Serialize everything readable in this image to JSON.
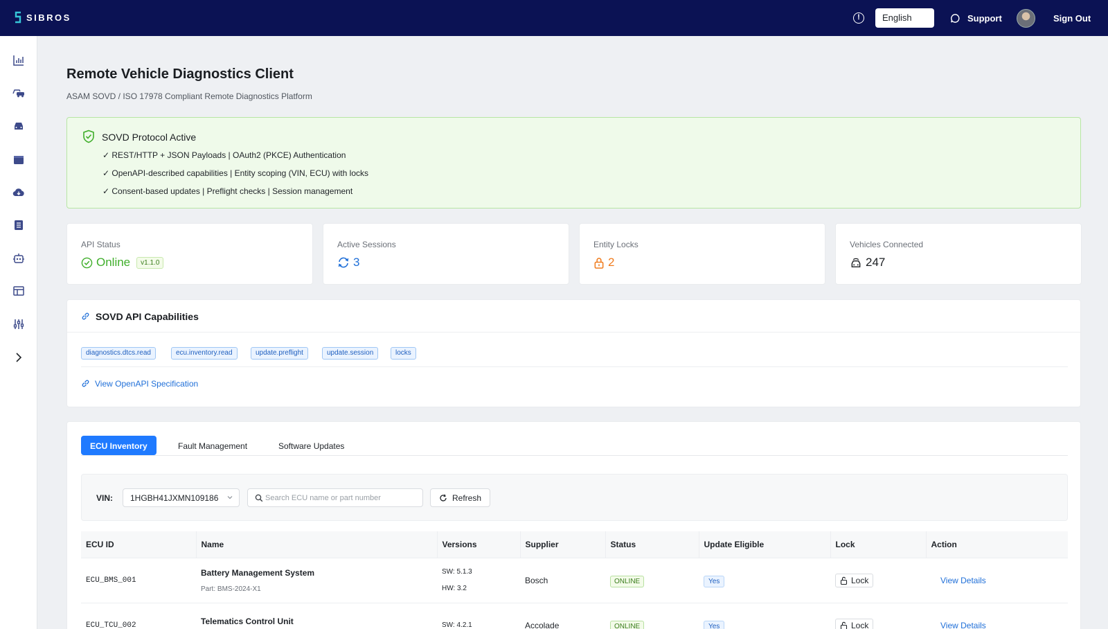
{
  "header": {
    "brand": "SIBROS",
    "language": "English",
    "support_label": "Support",
    "signout_label": "Sign Out"
  },
  "sidebar": {
    "items": [
      {
        "icon": "analytics-icon"
      },
      {
        "icon": "fleet-icon"
      },
      {
        "icon": "vehicle-icon"
      },
      {
        "icon": "package-icon"
      },
      {
        "icon": "cloud-download-icon"
      },
      {
        "icon": "reports-icon"
      },
      {
        "icon": "robot-icon"
      },
      {
        "icon": "dashboard-layout-icon"
      },
      {
        "icon": "settings-sliders-icon"
      },
      {
        "icon": "expand-chevron-icon"
      }
    ]
  },
  "page": {
    "title": "Remote Vehicle Diagnostics Client",
    "subtitle": "ASAM SOVD / ISO 17978 Compliant Remote Diagnostics Platform"
  },
  "banner": {
    "title": "SOVD Protocol Active",
    "lines": [
      "✓ REST/HTTP + JSON Payloads | OAuth2 (PKCE) Authentication",
      "✓ OpenAPI-described capabilities | Entity scoping (VIN, ECU) with locks",
      "✓ Consent-based updates | Preflight checks | Session management"
    ]
  },
  "stats": {
    "api_status": {
      "label": "API Status",
      "value": "Online",
      "version": "v1.1.0"
    },
    "active_sessions": {
      "label": "Active Sessions",
      "value": "3"
    },
    "entity_locks": {
      "label": "Entity Locks",
      "value": "2"
    },
    "vehicles_connected": {
      "label": "Vehicles Connected",
      "value": "247"
    }
  },
  "capabilities": {
    "title": "SOVD API Capabilities",
    "tags": [
      "diagnostics.dtcs.read",
      "ecu.inventory.read",
      "update.preflight",
      "update.session",
      "locks"
    ],
    "link_label": "View OpenAPI Specification"
  },
  "ecu_section": {
    "tabs": [
      "ECU Inventory",
      "Fault Management",
      "Software Updates"
    ],
    "active_tab": "ECU Inventory",
    "vin_label": "VIN:",
    "vin_value": "1HGBH41JXMN109186",
    "search_placeholder": "Search ECU name or part number",
    "refresh_label": "Refresh",
    "columns": [
      "ECU ID",
      "Name",
      "Versions",
      "Supplier",
      "Status",
      "Update Eligible",
      "Lock",
      "Action"
    ],
    "rows": [
      {
        "ecu_id": "ECU_BMS_001",
        "name": "Battery Management System",
        "part": "Part: BMS-2024-X1",
        "sw": "SW: 5.1.3",
        "hw": "HW: 3.2",
        "supplier": "Bosch",
        "status": "ONLINE",
        "eligible": "Yes",
        "lock": "Lock",
        "action": "View Details"
      },
      {
        "ecu_id": "ECU_TCU_002",
        "name": "Telematics Control Unit",
        "part": "",
        "sw": "SW: 4.2.1",
        "hw": "",
        "supplier": "Accolade",
        "status": "ONLINE",
        "eligible": "Yes",
        "lock": "Lock",
        "action": "View Details"
      }
    ]
  }
}
